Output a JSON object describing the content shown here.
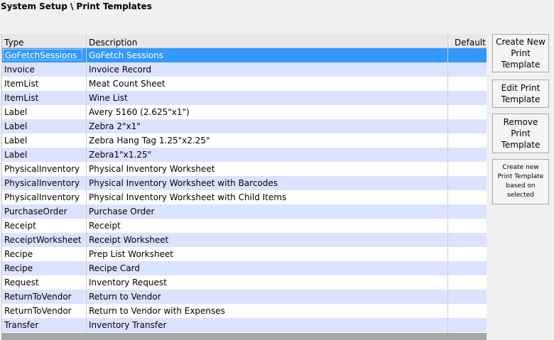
{
  "header": {
    "title": "System Setup \\ Print Templates"
  },
  "table": {
    "columns": {
      "type": "Type",
      "description": "Description",
      "default": "Default"
    },
    "rows": [
      {
        "type": "GoFetchSessions",
        "description": "GoFetch Sessions",
        "default": ""
      },
      {
        "type": "Invoice",
        "description": "Invoice Record",
        "default": ""
      },
      {
        "type": "ItemList",
        "description": "Meat Count Sheet",
        "default": ""
      },
      {
        "type": "ItemList",
        "description": "Wine List",
        "default": ""
      },
      {
        "type": "Label",
        "description": "Avery 5160 (2.625\"x1\")",
        "default": ""
      },
      {
        "type": "Label",
        "description": "Zebra 2\"x1\"",
        "default": ""
      },
      {
        "type": "Label",
        "description": "Zebra Hang Tag 1.25\"x2.25\"",
        "default": ""
      },
      {
        "type": "Label",
        "description": "Zebra1\"x1.25\"",
        "default": ""
      },
      {
        "type": "PhysicalInventory",
        "description": "Physical Inventory Worksheet",
        "default": ""
      },
      {
        "type": "PhysicalInventory",
        "description": "Physical Inventory Worksheet with Barcodes",
        "default": ""
      },
      {
        "type": "PhysicalInventory",
        "description": "Physical Inventory Worksheet with Child Items",
        "default": ""
      },
      {
        "type": "PurchaseOrder",
        "description": "Purchase Order",
        "default": ""
      },
      {
        "type": "Receipt",
        "description": "Receipt",
        "default": ""
      },
      {
        "type": "ReceiptWorksheet",
        "description": "Receipt Worksheet",
        "default": ""
      },
      {
        "type": "Recipe",
        "description": "Prep List Worksheet",
        "default": ""
      },
      {
        "type": "Recipe",
        "description": "Recipe Card",
        "default": ""
      },
      {
        "type": "Request",
        "description": "Inventory Request",
        "default": ""
      },
      {
        "type": "ReturnToVendor",
        "description": "Return to Vendor",
        "default": ""
      },
      {
        "type": "ReturnToVendor",
        "description": "Return to Vendor with Expenses",
        "default": ""
      },
      {
        "type": "Transfer",
        "description": "Inventory Transfer",
        "default": ""
      }
    ],
    "selected_index": 0
  },
  "buttons": {
    "create": "Create New Print Template",
    "edit": "Edit Print Template",
    "remove": "Remove Print Template",
    "create_based": "Create new Print Template based on selected"
  },
  "colors": {
    "selected_row": "#3399ff",
    "alt_row": "#dce3ff",
    "header_bg": "#e8e8e8"
  }
}
